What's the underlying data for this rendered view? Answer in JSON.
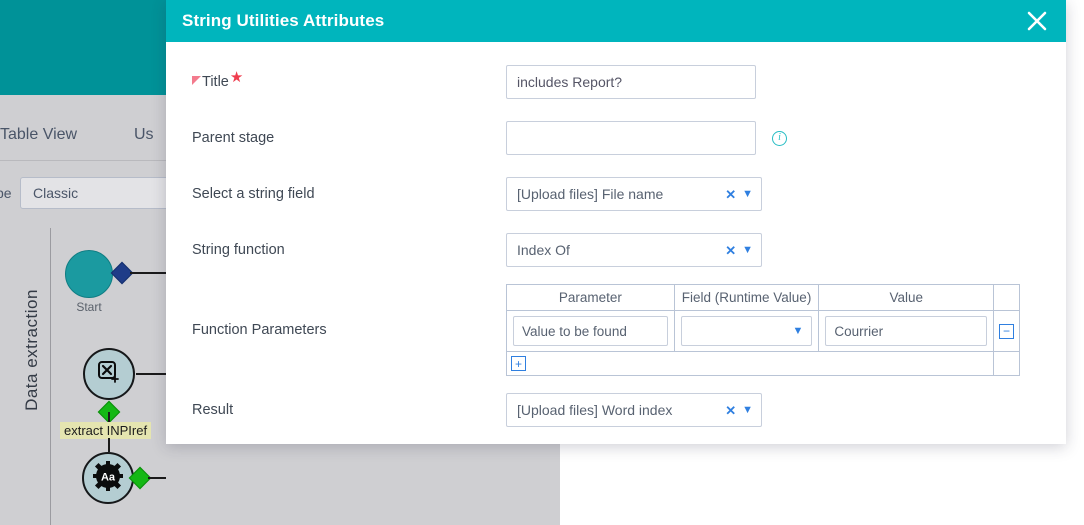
{
  "background": {
    "tabs": [
      {
        "label": "Table View"
      },
      {
        "label": "Us"
      }
    ],
    "subbar": {
      "label": "pe",
      "select_value": "Classic"
    },
    "workflow": {
      "lane_label": "Data extraction",
      "start_label": "Start",
      "nodes": [
        {
          "icon": "extract-field-icon",
          "glyph": "⌧"
        },
        {
          "icon": "string-utilities-gear-icon",
          "glyph": "Aa"
        }
      ],
      "edge_label": "extract INPIref"
    }
  },
  "modal": {
    "title": "String Utilities Attributes",
    "close_icon": "close-icon",
    "fields": {
      "title": {
        "label": "Title",
        "required": true,
        "value": "includes Report?",
        "placeholder": ""
      },
      "parent_stage": {
        "label": "Parent stage",
        "value": "",
        "placeholder": "",
        "info_icon": "info-icon"
      },
      "string_field": {
        "label": "Select a string field",
        "value": "[Upload files] File name",
        "clear_icon": "clear-icon",
        "caret_icon": "chevron-down-icon"
      },
      "string_function": {
        "label": "String function",
        "value": "Index Of",
        "clear_icon": "clear-icon",
        "caret_icon": "chevron-down-icon"
      },
      "function_parameters": {
        "label": "Function Parameters",
        "columns": [
          "Parameter",
          "Field (Runtime Value)",
          "Value"
        ],
        "rows": [
          {
            "parameter": "Value to be found",
            "field_runtime_value": "",
            "value": "Courrier",
            "remove_icon": "minus-square-icon"
          }
        ],
        "add_icon": "plus-square-icon"
      },
      "result": {
        "label": "Result",
        "value": "[Upload files] Word index",
        "clear_icon": "clear-icon",
        "caret_icon": "chevron-down-icon"
      }
    }
  },
  "colors": {
    "header_teal": "#00b5bd",
    "app_teal": "#009298",
    "accent_blue": "#2f7fe0",
    "required_red": "#ef3d4e",
    "node_green": "#14b814",
    "node_navy": "#1f3c88"
  }
}
